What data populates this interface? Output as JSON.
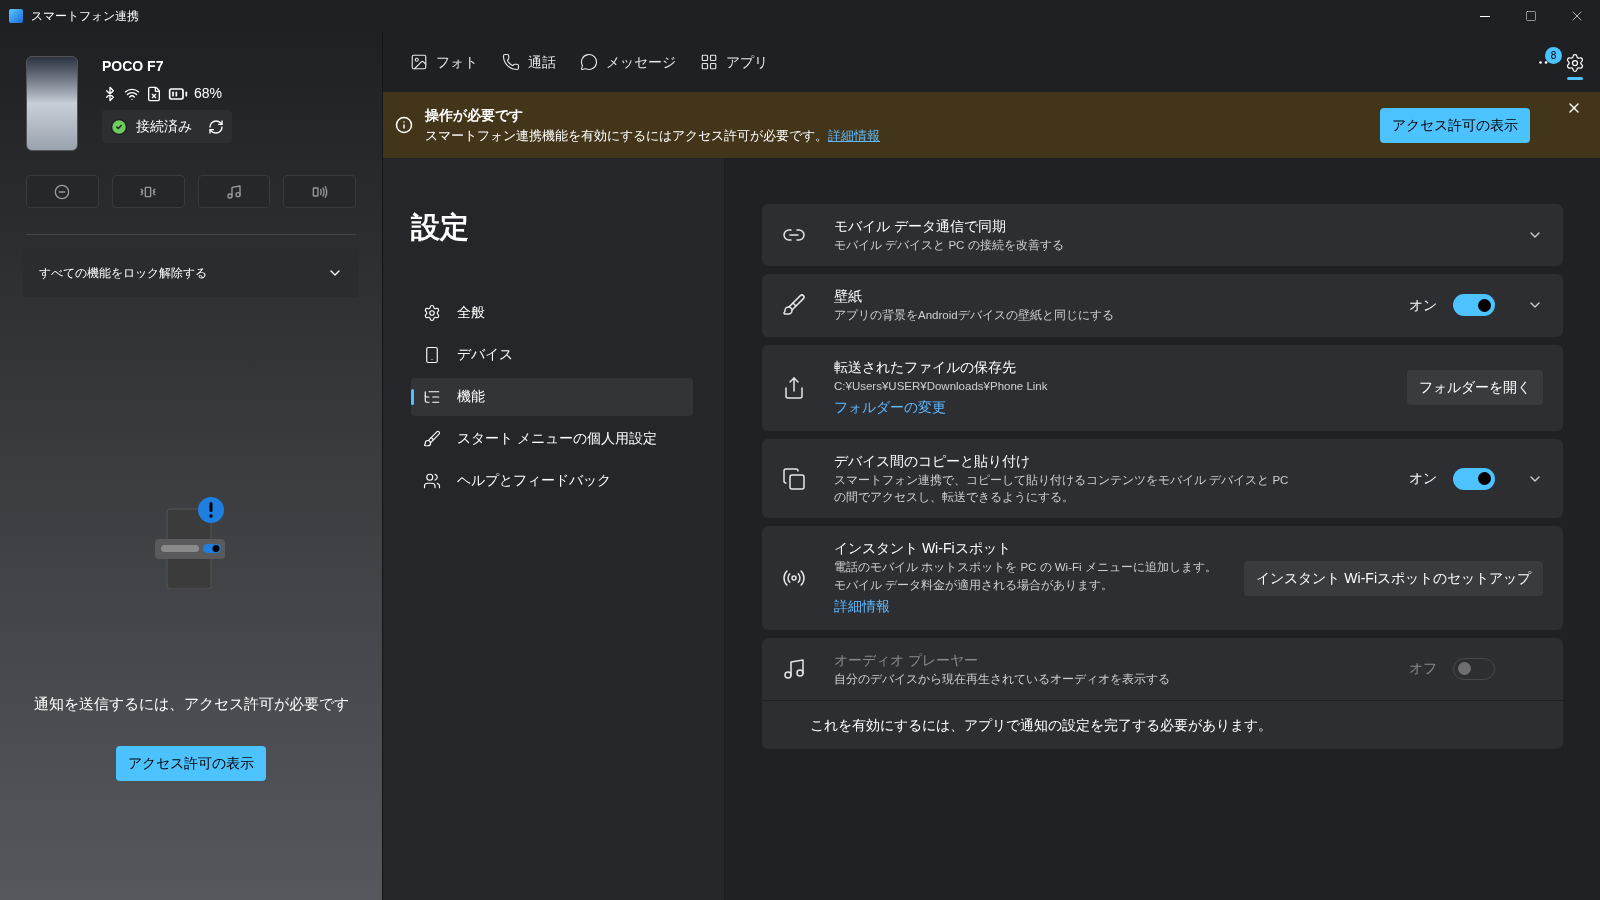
{
  "window": {
    "title": "スマートフォン連携"
  },
  "device": {
    "name": "POCO F7",
    "battery": "68%",
    "status": "接続済み"
  },
  "unlock_dropdown": {
    "label": "すべての機能をロック解除する",
    "expanded": false
  },
  "permission_prompt": {
    "message": "通知を送信するには、アクセス許可が必要です",
    "button": "アクセス許可の表示"
  },
  "top_nav": {
    "tabs": [
      {
        "label": "フォト",
        "selected": false
      },
      {
        "label": "通話",
        "selected": false
      },
      {
        "label": "メッセージ",
        "selected": false
      },
      {
        "label": "アプリ",
        "selected": false
      }
    ],
    "more_badge": "8",
    "settings_selected": true
  },
  "banner": {
    "title": "操作が必要です",
    "message": "スマートフォン連携機能を有効にするにはアクセス許可が必要です。",
    "link": "詳細情報",
    "button": "アクセス許可の表示"
  },
  "settings": {
    "title": "設定",
    "items": [
      {
        "label": "全般",
        "selected": false
      },
      {
        "label": "デバイス",
        "selected": false
      },
      {
        "label": "機能",
        "selected": true
      },
      {
        "label": "スタート メニューの個人用設定",
        "selected": false
      },
      {
        "label": "ヘルプとフィードバック",
        "selected": false
      }
    ]
  },
  "cards": [
    {
      "kind": "expander",
      "title": "モバイル データ通信で同期",
      "description": "モバイル デバイスと PC の接続を改善する",
      "disabled": false
    },
    {
      "kind": "toggle",
      "title": "壁紙",
      "description": "アプリの背景をAndroidデバイスの壁紙と同じにする",
      "on": true,
      "state_label": "オン",
      "expandable": true,
      "disabled": false
    },
    {
      "kind": "button",
      "title": "転送されたファイルの保存先",
      "description": "C:¥Users¥USER¥Downloads¥Phone Link",
      "link": "フォルダーの変更",
      "button": "フォルダーを開く",
      "disabled": false
    },
    {
      "kind": "toggle",
      "title": "デバイス間のコピーと貼り付け",
      "description": "スマートフォン連携で、コピーして貼り付けるコンテンツをモバイル デバイスと PC の間でアクセスし、転送できるようにする。",
      "on": true,
      "state_label": "オン",
      "expandable": true,
      "disabled": false
    },
    {
      "kind": "button",
      "title": "インスタント Wi-Fiスポット",
      "description": "電話のモバイル ホットスポットを PC の Wi-Fi メニューに追加します。モバイル データ料金が適用される場合があります。",
      "link": "詳細情報",
      "button": "インスタント Wi-Fiスポットのセットアップ",
      "disabled": false
    },
    {
      "kind": "toggle",
      "title": "オーディオ プレーヤー",
      "description": "自分のデバイスから現在再生されているオーディオを表示する",
      "on": false,
      "state_label": "オフ",
      "expandable": false,
      "disabled": true,
      "note": "これを有効にするには、アプリで通知の設定を完了する必要があります。"
    }
  ]
}
